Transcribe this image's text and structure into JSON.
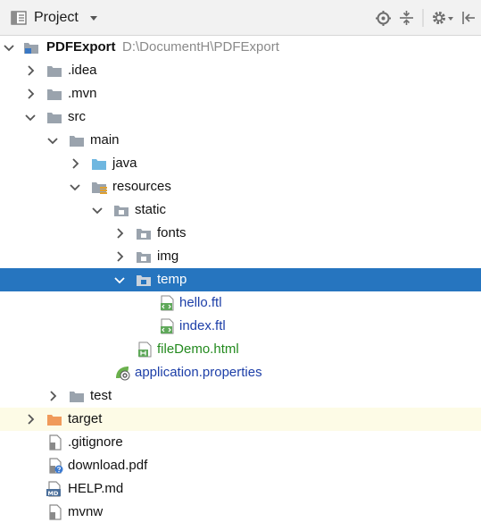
{
  "toolbar": {
    "title": "Project",
    "icons": [
      "project-view-icon",
      "dropdown-icon",
      "locate-icon",
      "collapse-all-icon",
      "settings-icon",
      "hide-icon"
    ]
  },
  "tree": {
    "root": {
      "label": "PDFExport",
      "path": "D:\\DocumentH\\PDFExport"
    },
    "items": {
      "idea": ".idea",
      "mvn": ".mvn",
      "src": "src",
      "main": "main",
      "java": "java",
      "resources": "resources",
      "static": "static",
      "fonts": "fonts",
      "img": "img",
      "temp": "temp",
      "hello": "hello.ftl",
      "index": "index.ftl",
      "filedemo": "fileDemo.html",
      "appprops": "application.properties",
      "test": "test",
      "target": "target",
      "gitignore": ".gitignore",
      "download": "download.pdf",
      "help": "HELP.md",
      "mvnw": "mvnw"
    },
    "selected": "temp"
  },
  "colors": {
    "selection": "#2675bf",
    "excluded_row": "#fdfbe6",
    "file_modified": "#1d3fa8",
    "file_new": "#238a1e"
  }
}
